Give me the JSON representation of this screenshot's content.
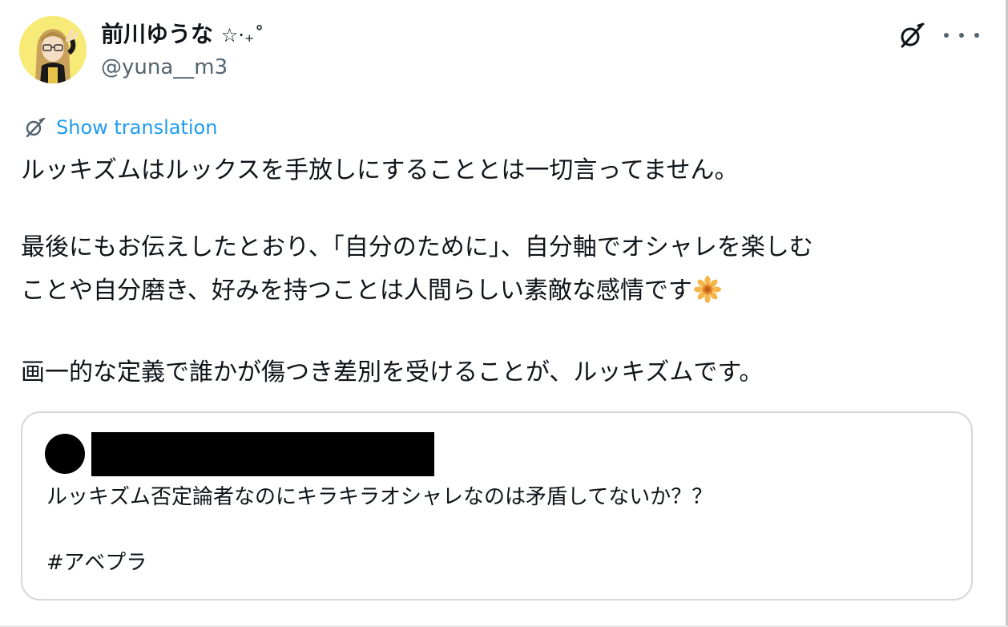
{
  "author": {
    "display_name": "前川ゆうな",
    "name_decoration": "☆⋅₊˚",
    "handle": "@yuna__m3",
    "avatar_icon": "user-avatar-illustration"
  },
  "actions": {
    "grok_icon": "grok-slashed-circle-icon",
    "more_icon": "more-dots-icon"
  },
  "translation": {
    "label": "Show translation",
    "color": "#1d9bf0"
  },
  "tweet": {
    "lines": [
      "ルッキズムはルックスを手放しにすることとは一切言ってません。",
      "最後にもお伝えしたとおり、「自分のために」、自分軸でオシャレを楽しむ",
      "ことや自分磨き、好みを持つことは人間らしい素敵な感情です",
      "画一的な定義で誰かが傷つき差別を受けることが、ルッキズムです。"
    ],
    "emoji": "sunflower-emoji"
  },
  "quote": {
    "author_redacted": true,
    "text": "ルッキズム否定論者なのにキラキラオシャレなのは矛盾してないか？？",
    "hashtag": "#アベプラ"
  },
  "colors": {
    "text": "#0f1419",
    "secondary": "#536471",
    "link": "#1d9bf0",
    "border": "#d4d8dc"
  }
}
